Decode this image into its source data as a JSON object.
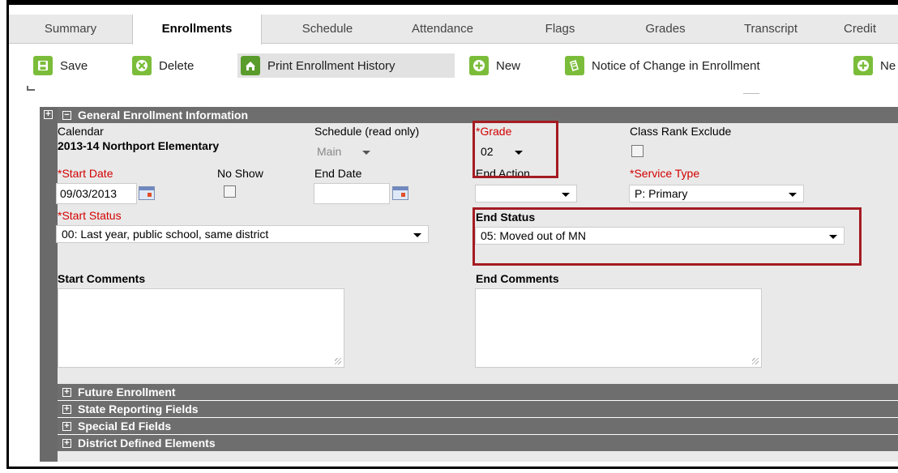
{
  "tabs": [
    {
      "label": "Summary",
      "active": false
    },
    {
      "label": "Enrollments",
      "active": true
    },
    {
      "label": "Schedule",
      "active": false
    },
    {
      "label": "Attendance",
      "active": false
    },
    {
      "label": "Flags",
      "active": false
    },
    {
      "label": "Grades",
      "active": false
    },
    {
      "label": "Transcript",
      "active": false
    },
    {
      "label": "Credit",
      "active": false
    }
  ],
  "toolbar": {
    "save": "Save",
    "delete": "Delete",
    "print_history": "Print Enrollment History",
    "new": "New",
    "notice": "Notice of Change in Enrollment",
    "new2": "Ne"
  },
  "sections": {
    "general": "General Enrollment Information",
    "future": "Future Enrollment",
    "state": "State Reporting Fields",
    "special_ed": "Special Ed Fields",
    "district": "District Defined Elements"
  },
  "form": {
    "calendar_label": "Calendar",
    "calendar_value": "2013-14 Northport Elementary",
    "schedule_label": "Schedule (read only)",
    "schedule_value": "Main",
    "grade_label": "*Grade",
    "grade_value": "02",
    "class_rank_label": "Class Rank Exclude",
    "start_date_label": "*Start Date",
    "start_date_value": "09/03/2013",
    "no_show_label": "No Show",
    "end_date_label": "End Date",
    "end_date_value": "",
    "end_action_label": "End Action",
    "end_action_value": "",
    "service_type_label": "*Service Type",
    "service_type_value": "P: Primary",
    "start_status_label": "*Start Status",
    "start_status_value": "00: Last year, public school, same district",
    "end_status_label": "End Status",
    "end_status_value": "05: Moved out of MN",
    "start_comments_label": "Start Comments",
    "end_comments_label": "End Comments"
  },
  "colors": {
    "accent_green": "#7bbd3a",
    "highlight_red": "#a51b22",
    "required_red": "#d30000",
    "section_gray": "#6e6e6e"
  }
}
